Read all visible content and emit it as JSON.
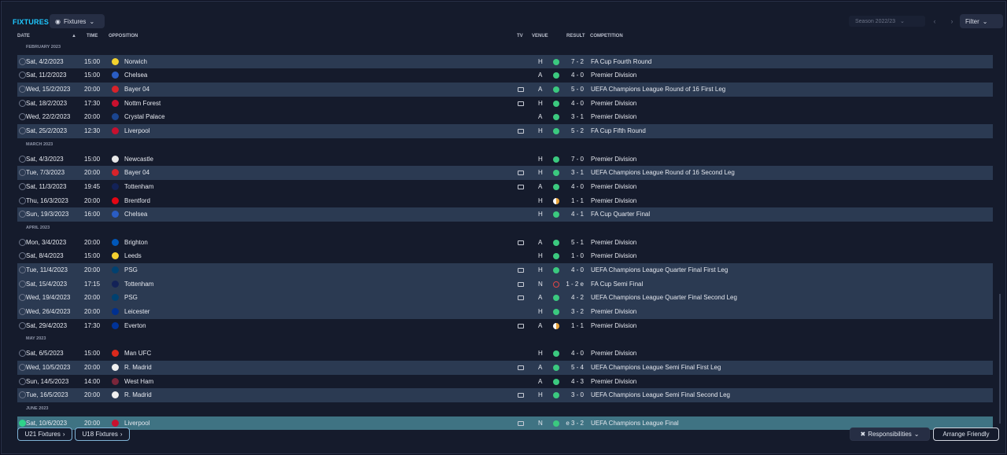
{
  "header": {
    "title": "FIXTURES",
    "view_label": "Fixtures",
    "season_label": "Season 2022/23",
    "filter_label": "Filter"
  },
  "columns": {
    "date": "DATE",
    "time": "TIME",
    "opposition": "OPPOSITION",
    "tv": "TV",
    "venue": "VENUE",
    "result": "RESULT",
    "competition": "COMPETITION"
  },
  "rows": [
    {
      "section": "FEBRUARY 2023"
    },
    {
      "date": "Sat, 4/2/2023",
      "time": "15:00",
      "team": "Norwich",
      "crest": "#f2d22e",
      "tv": false,
      "venue": "H",
      "outcome": "win",
      "result": "7 - 2",
      "competition": "FA Cup Fourth Round",
      "alt": true
    },
    {
      "date": "Sat, 11/2/2023",
      "time": "15:00",
      "team": "Chelsea",
      "crest": "#2a5dc4",
      "tv": false,
      "venue": "A",
      "outcome": "win",
      "result": "4 - 0",
      "competition": "Premier Division",
      "alt": false
    },
    {
      "date": "Wed, 15/2/2023",
      "time": "20:00",
      "team": "Bayer 04",
      "crest": "#d8232a",
      "tv": true,
      "venue": "A",
      "outcome": "win",
      "result": "5 - 0",
      "competition": "UEFA Champions League Round of 16  First Leg",
      "alt": true
    },
    {
      "date": "Sat, 18/2/2023",
      "time": "17:30",
      "team": "Nottm Forest",
      "crest": "#c8102e",
      "tv": true,
      "venue": "H",
      "outcome": "win",
      "result": "4 - 0",
      "competition": "Premier Division",
      "alt": false
    },
    {
      "date": "Wed, 22/2/2023",
      "time": "20:00",
      "team": "Crystal Palace",
      "crest": "#1b458f",
      "tv": false,
      "venue": "A",
      "outcome": "win",
      "result": "3 - 1",
      "competition": "Premier Division",
      "alt": false
    },
    {
      "date": "Sat, 25/2/2023",
      "time": "12:30",
      "team": "Liverpool",
      "crest": "#c8102e",
      "tv": true,
      "venue": "H",
      "outcome": "win",
      "result": "5 - 2",
      "competition": "FA Cup Fifth Round",
      "alt": true
    },
    {
      "section": "MARCH 2023"
    },
    {
      "date": "Sat, 4/3/2023",
      "time": "15:00",
      "team": "Newcastle",
      "crest": "#e8e8e8",
      "tv": false,
      "venue": "H",
      "outcome": "win",
      "result": "7 - 0",
      "competition": "Premier Division",
      "alt": false
    },
    {
      "date": "Tue, 7/3/2023",
      "time": "20:00",
      "team": "Bayer 04",
      "crest": "#d8232a",
      "tv": true,
      "venue": "H",
      "outcome": "win",
      "result": "3 - 1",
      "competition": "UEFA Champions League Round of 16  Second Leg",
      "alt": true
    },
    {
      "date": "Sat, 11/3/2023",
      "time": "19:45",
      "team": "Tottenham",
      "crest": "#132257",
      "tv": true,
      "venue": "A",
      "outcome": "win",
      "result": "4 - 0",
      "competition": "Premier Division",
      "alt": false
    },
    {
      "date": "Thu, 16/3/2023",
      "time": "20:00",
      "team": "Brentford",
      "crest": "#e30613",
      "tv": false,
      "venue": "H",
      "outcome": "draw",
      "result": "1 - 1",
      "competition": "Premier Division",
      "alt": false
    },
    {
      "date": "Sun, 19/3/2023",
      "time": "16:00",
      "team": "Chelsea",
      "crest": "#2a5dc4",
      "tv": false,
      "venue": "H",
      "outcome": "win",
      "result": "4 - 1",
      "competition": "FA Cup Quarter Final",
      "alt": true
    },
    {
      "section": "APRIL 2023"
    },
    {
      "date": "Mon, 3/4/2023",
      "time": "20:00",
      "team": "Brighton",
      "crest": "#0057b8",
      "tv": true,
      "venue": "A",
      "outcome": "win",
      "result": "5 - 1",
      "competition": "Premier Division",
      "alt": false
    },
    {
      "date": "Sat, 8/4/2023",
      "time": "15:00",
      "team": "Leeds",
      "crest": "#f5d130",
      "tv": false,
      "venue": "H",
      "outcome": "win",
      "result": "1 - 0",
      "competition": "Premier Division",
      "alt": false
    },
    {
      "date": "Tue, 11/4/2023",
      "time": "20:00",
      "team": "PSG",
      "crest": "#004170",
      "tv": true,
      "venue": "H",
      "outcome": "win",
      "result": "4 - 0",
      "competition": "UEFA Champions League Quarter Final First Leg",
      "alt": true
    },
    {
      "date": "Sat, 15/4/2023",
      "time": "17:15",
      "team": "Tottenham",
      "crest": "#132257",
      "tv": true,
      "venue": "N",
      "outcome": "loss",
      "result": "1 - 2 e",
      "competition": "FA Cup Semi Final",
      "alt": true
    },
    {
      "date": "Wed, 19/4/2023",
      "time": "20:00",
      "team": "PSG",
      "crest": "#004170",
      "tv": true,
      "venue": "A",
      "outcome": "win",
      "result": "4 - 2",
      "competition": "UEFA Champions League Quarter Final Second Leg",
      "alt": true
    },
    {
      "date": "Wed, 26/4/2023",
      "time": "20:00",
      "team": "Leicester",
      "crest": "#003090",
      "tv": false,
      "venue": "H",
      "outcome": "win",
      "result": "3 - 2",
      "competition": "Premier Division",
      "alt": true
    },
    {
      "date": "Sat, 29/4/2023",
      "time": "17:30",
      "team": "Everton",
      "crest": "#003399",
      "tv": true,
      "venue": "A",
      "outcome": "draw",
      "result": "1 - 1",
      "competition": "Premier Division",
      "alt": false
    },
    {
      "section": "MAY 2023"
    },
    {
      "date": "Sat, 6/5/2023",
      "time": "15:00",
      "team": "Man UFC",
      "crest": "#da291c",
      "tv": false,
      "venue": "H",
      "outcome": "win",
      "result": "4 - 0",
      "competition": "Premier Division",
      "alt": false
    },
    {
      "date": "Wed, 10/5/2023",
      "time": "20:00",
      "team": "R. Madrid",
      "crest": "#f0f0f0",
      "tv": true,
      "venue": "A",
      "outcome": "win",
      "result": "5 - 4",
      "competition": "UEFA Champions League Semi Final First Leg",
      "alt": true
    },
    {
      "date": "Sun, 14/5/2023",
      "time": "14:00",
      "team": "West Ham",
      "crest": "#7a263a",
      "tv": false,
      "venue": "A",
      "outcome": "win",
      "result": "4 - 3",
      "competition": "Premier Division",
      "alt": false
    },
    {
      "date": "Tue, 16/5/2023",
      "time": "20:00",
      "team": "R. Madrid",
      "crest": "#f0f0f0",
      "tv": true,
      "venue": "H",
      "outcome": "win",
      "result": "3 - 0",
      "competition": "UEFA Champions League Semi Final Second Leg",
      "alt": true
    },
    {
      "section": "JUNE 2023"
    },
    {
      "date": "Sat, 10/6/2023",
      "time": "20:00",
      "team": "Liverpool",
      "crest": "#c8102e",
      "tv": true,
      "venue": "N",
      "outcome": "win",
      "result": "e 3 - 2",
      "competition": "UEFA Champions League Final",
      "alt": false,
      "selected": true
    }
  ],
  "footer": {
    "u21_label": "U21 Fixtures",
    "u18_label": "U18 Fixtures",
    "responsibilities_label": "Responsibilities",
    "arrange_label": "Arrange Friendly"
  }
}
